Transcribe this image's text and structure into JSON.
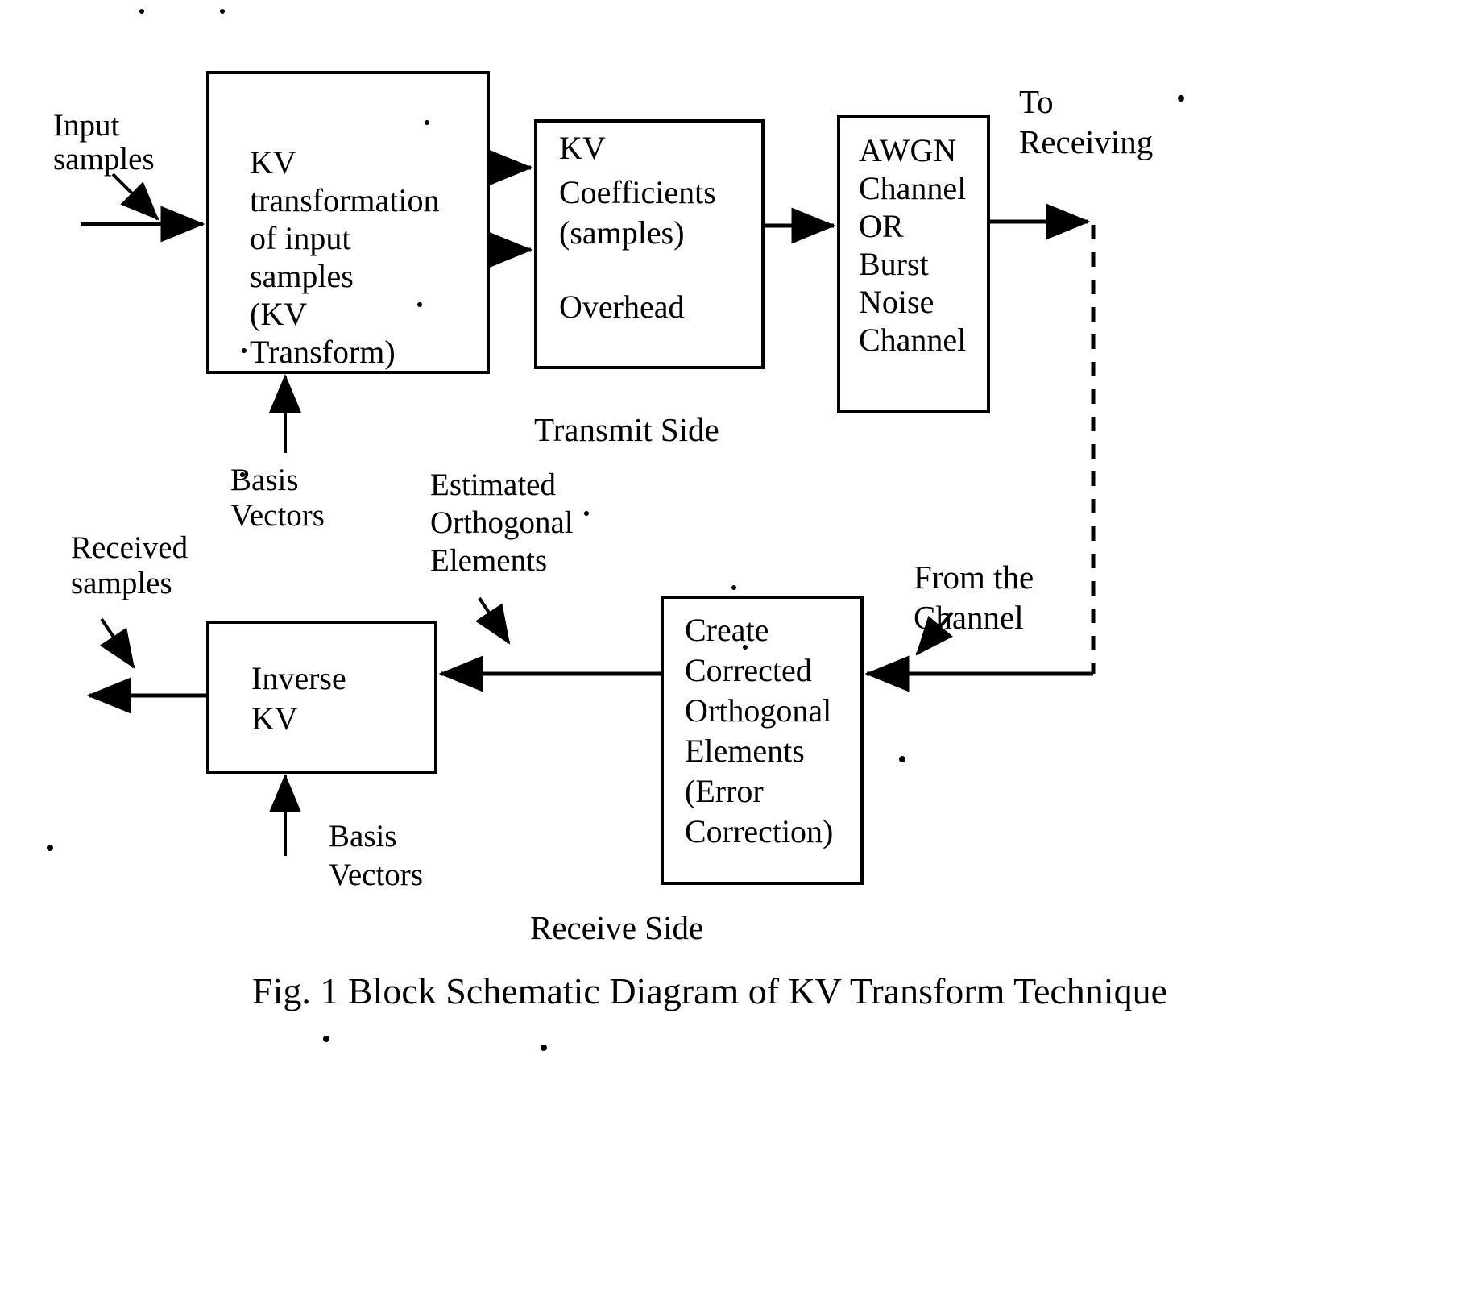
{
  "figure": {
    "caption": "Fig. 1 Block Schematic Diagram of KV Transform Technique",
    "transmit_side_label": "Transmit Side",
    "receive_side_label": "Receive Side"
  },
  "blocks": {
    "kv_transform": {
      "lines": [
        "KV",
        "transformation",
        "of input",
        "samples",
        "(KV",
        "Transform)"
      ]
    },
    "kv_coefficients": {
      "lines": [
        "KV",
        "Coefficients",
        "(samples)",
        "",
        "Overhead"
      ]
    },
    "channel": {
      "lines": [
        "AWGN",
        "Channel",
        "OR",
        "Burst",
        "Noise",
        "Channel"
      ]
    },
    "inverse_kv": {
      "lines": [
        "Inverse",
        "KV"
      ]
    },
    "create_corrected": {
      "lines": [
        "Create",
        "Corrected",
        "Orthogonal",
        "Elements",
        "(Error",
        "Correction)"
      ]
    }
  },
  "labels": {
    "input_samples": [
      "Input",
      "samples"
    ],
    "basis_vectors_tx": [
      "Basis",
      "Vectors"
    ],
    "estimated_orthogonal": [
      "Estimated",
      "Orthogonal",
      "Elements"
    ],
    "to_receiving": [
      "To",
      "Receiving"
    ],
    "received_samples": [
      "Received",
      "samples"
    ],
    "basis_vectors_rx": [
      "Basis",
      "Vectors"
    ],
    "from_the_channel": [
      "From the",
      "Channel"
    ]
  },
  "colors": {
    "ink": "#000000",
    "paper": "#ffffff"
  }
}
